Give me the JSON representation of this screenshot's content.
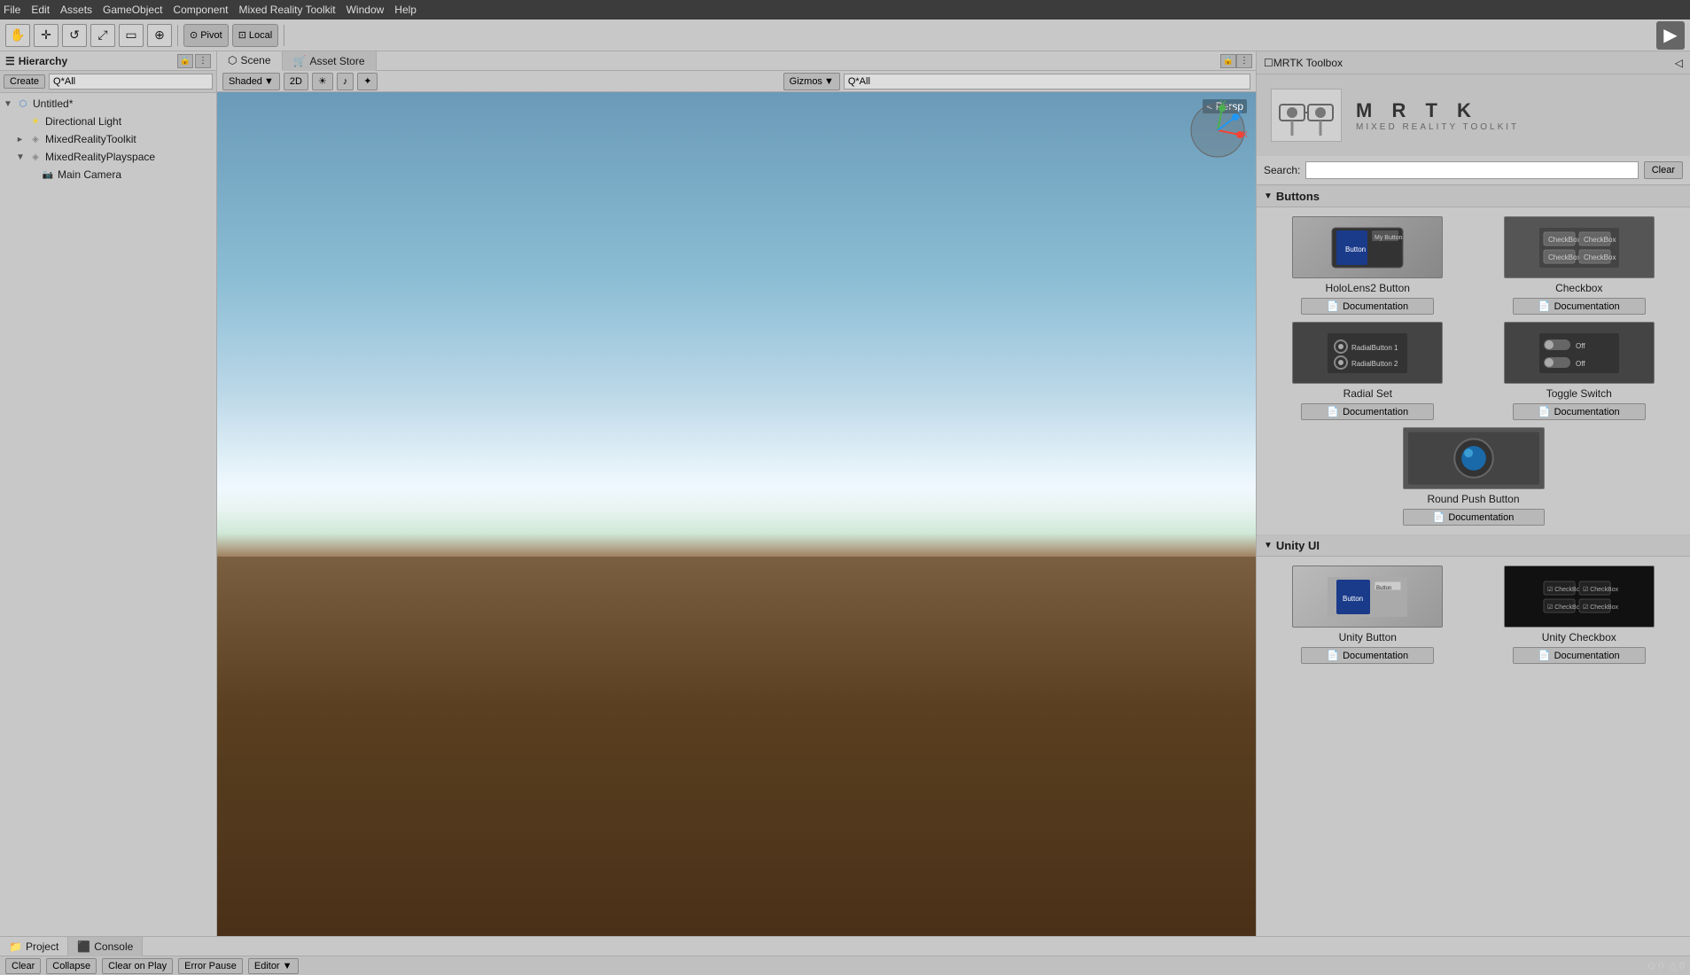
{
  "menubar": {
    "items": [
      "File",
      "Edit",
      "Assets",
      "GameObject",
      "Component",
      "Mixed Reality Toolkit",
      "Window",
      "Help"
    ]
  },
  "toolbar": {
    "transform_tools": [
      "hand-icon",
      "move-icon",
      "rotate-icon",
      "scale-icon",
      "rect-icon",
      "transform-icon"
    ],
    "pivot_label": "Pivot",
    "local_label": "Local",
    "play_button": "▶"
  },
  "hierarchy": {
    "title": "Hierarchy",
    "create_label": "Create",
    "search_placeholder": "Q*All",
    "items": [
      {
        "id": "untitled",
        "label": "Untitled*",
        "depth": 0,
        "arrow": "▼",
        "icon": "scene-icon"
      },
      {
        "id": "directional-light",
        "label": "Directional Light",
        "depth": 1,
        "arrow": "",
        "icon": "light-icon"
      },
      {
        "id": "mrtk",
        "label": "MixedRealityToolkit",
        "depth": 1,
        "arrow": "►",
        "icon": "object-icon"
      },
      {
        "id": "mrtkp",
        "label": "MixedRealityPlayspace",
        "depth": 1,
        "arrow": "▼",
        "icon": "object-icon"
      },
      {
        "id": "main-camera",
        "label": "Main Camera",
        "depth": 2,
        "arrow": "",
        "icon": "camera-icon"
      }
    ]
  },
  "scene": {
    "tabs": [
      {
        "id": "scene",
        "label": "Scene",
        "icon": "scene-tab-icon"
      },
      {
        "id": "asset-store",
        "label": "Asset Store",
        "icon": "asset-icon"
      }
    ],
    "active_tab": "scene",
    "toolbar": {
      "shading": "Shaded",
      "mode_2d": "2D",
      "gizmos": "Gizmos",
      "filter": "Q*All"
    },
    "persp_label": "< Persp"
  },
  "toolbox": {
    "window_title": "MRTK Toolbox",
    "logo": {
      "title": "M R T K",
      "subtitle": "MIXED REALITY TOOLKIT"
    },
    "search": {
      "label": "Search:",
      "placeholder": "",
      "clear_label": "Clear"
    },
    "sections": [
      {
        "id": "buttons",
        "label": "Buttons",
        "items": [
          {
            "id": "holol2-btn",
            "label": "HoloLens2 Button",
            "doc_label": "Documentation",
            "preview_type": "hl-button"
          },
          {
            "id": "checkbox",
            "label": "Checkbox",
            "doc_label": "Documentation",
            "preview_type": "checkbox"
          },
          {
            "id": "radial-set",
            "label": "Radial Set",
            "doc_label": "Documentation",
            "preview_type": "radial"
          },
          {
            "id": "toggle-switch",
            "label": "Toggle Switch",
            "doc_label": "Documentation",
            "preview_type": "toggle"
          },
          {
            "id": "round-push",
            "label": "Round Push Button",
            "doc_label": "Documentation",
            "preview_type": "round",
            "centered": true
          }
        ]
      },
      {
        "id": "unity-ui",
        "label": "Unity UI",
        "items": [
          {
            "id": "unity-btn",
            "label": "Unity Button",
            "doc_label": "Documentation",
            "preview_type": "unity-btn"
          },
          {
            "id": "unity-check",
            "label": "Unity Checkbox",
            "doc_label": "Documentation",
            "preview_type": "unity-check"
          }
        ]
      }
    ]
  },
  "bottom_tabs": [
    {
      "id": "project",
      "label": "Project",
      "icon": "project-icon",
      "active": false
    },
    {
      "id": "console",
      "label": "Console",
      "icon": "console-icon",
      "active": true
    }
  ],
  "console_toolbar": {
    "buttons": [
      "Clear",
      "Collapse",
      "Clear on Play",
      "Error Pause",
      "Editor"
    ]
  },
  "status_bar": {
    "clear_label": "Clear",
    "items": [
      "⊙ 0",
      "△ 0"
    ]
  }
}
